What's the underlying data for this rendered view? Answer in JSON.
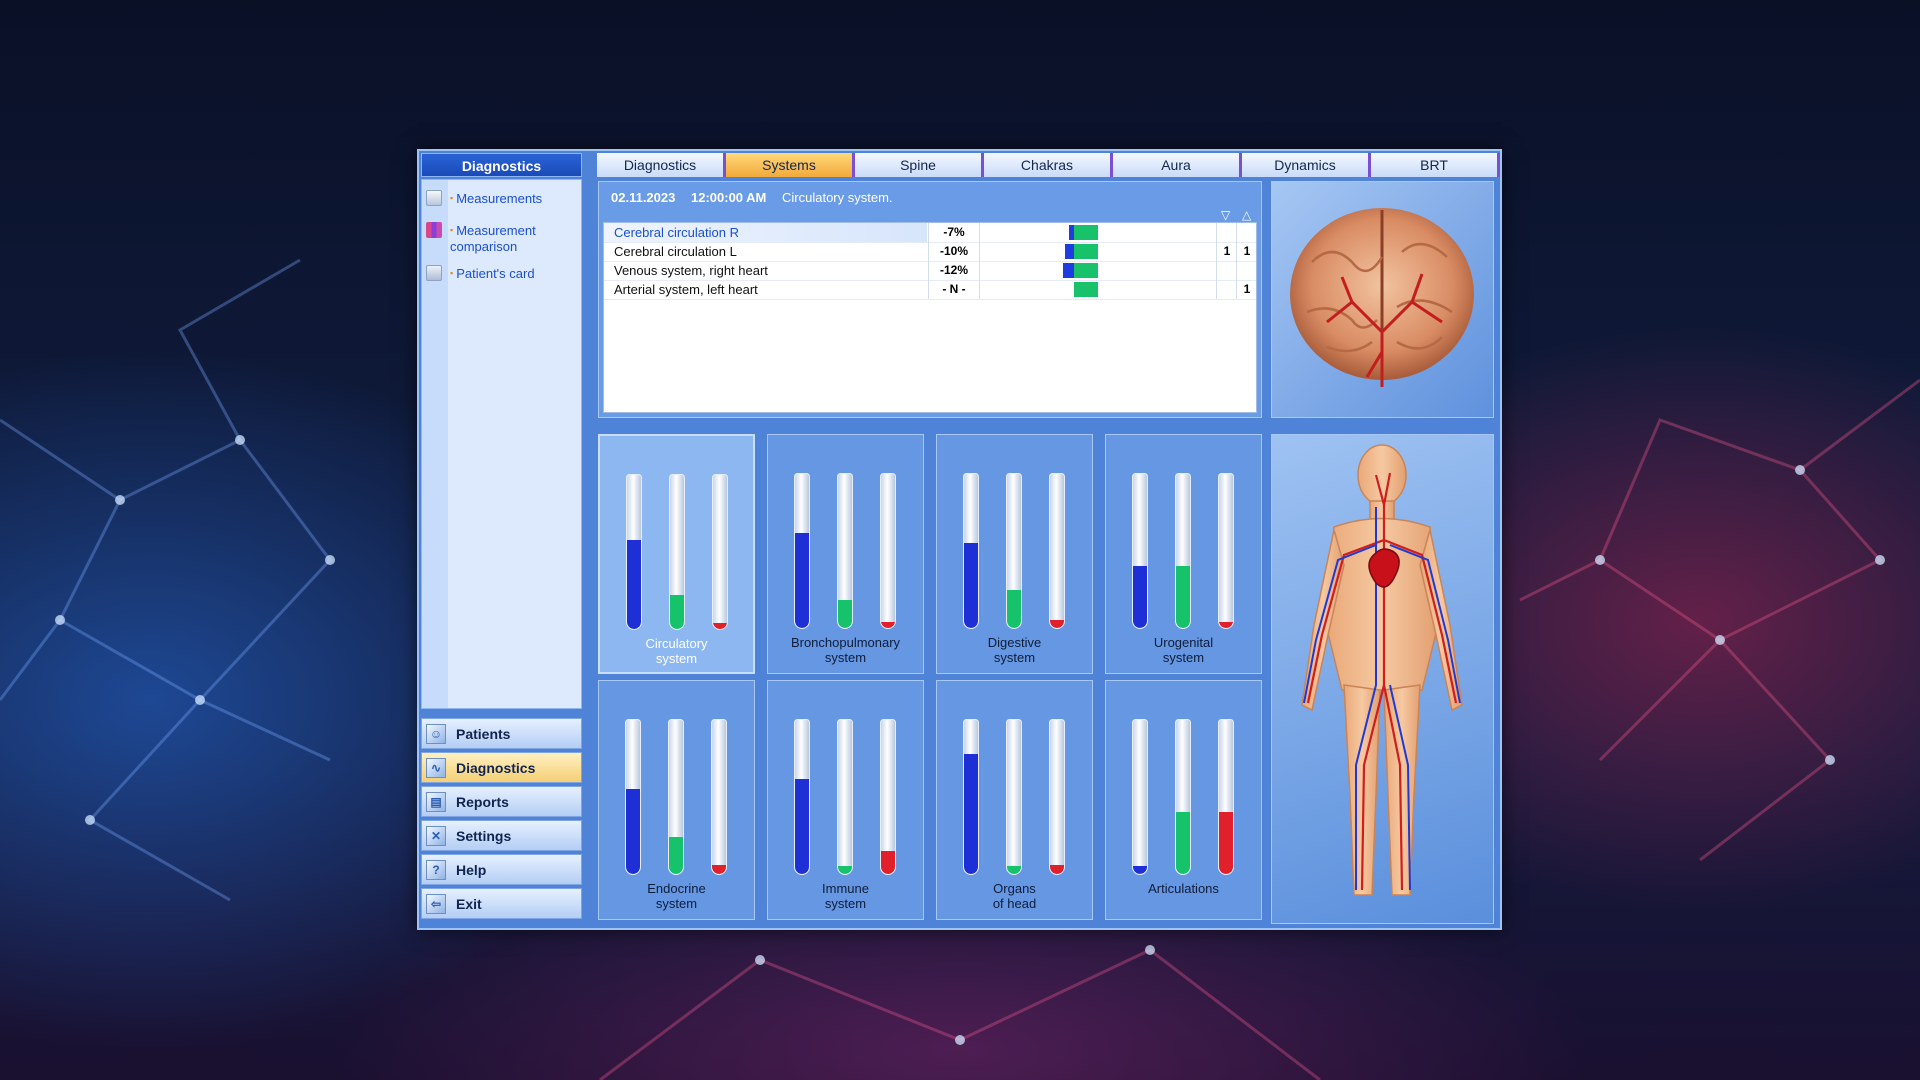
{
  "left_panel": {
    "title": "Diagnostics",
    "menu": [
      {
        "label": "Measurements",
        "icon": "table-icon"
      },
      {
        "label": "Measurement comparison",
        "icon": "chart-icon"
      },
      {
        "label": "Patient's card",
        "icon": "book-icon"
      }
    ]
  },
  "nav": [
    {
      "label": "Patients",
      "icon": "patients-icon"
    },
    {
      "label": "Diagnostics",
      "icon": "diagnostics-icon",
      "active": true
    },
    {
      "label": "Reports",
      "icon": "reports-icon"
    },
    {
      "label": "Settings",
      "icon": "settings-icon"
    },
    {
      "label": "Help",
      "icon": "help-icon"
    },
    {
      "label": "Exit",
      "icon": "exit-icon"
    }
  ],
  "tabs": [
    "Diagnostics",
    "Systems",
    "Spine",
    "Chakras",
    "Aura",
    "Dynamics",
    "BRT"
  ],
  "active_tab": "Systems",
  "info": {
    "date": "02.11.2023",
    "time": "12:00:00 AM",
    "system": "Circulatory system.",
    "sort_down": "▽",
    "sort_up": "△",
    "rows": [
      {
        "name": "Cerebral circulation R",
        "value": "-7%",
        "c1": "",
        "c2": "",
        "selected": true,
        "blue_level": 0.03
      },
      {
        "name": "Cerebral circulation L",
        "value": "-10%",
        "c1": "1",
        "c2": "1",
        "blue_level": 0.04
      },
      {
        "name": "Venous system, right heart",
        "value": "-12%",
        "c1": "",
        "c2": "",
        "blue_level": 0.05
      },
      {
        "name": "Arterial system, left heart",
        "value": "- N -",
        "c1": "",
        "c2": "1",
        "blue_level": 0
      }
    ]
  },
  "systems": [
    {
      "label_1": "Circulatory",
      "label_2": "system",
      "levels": [
        0.58,
        0.22,
        0.04
      ],
      "active": true
    },
    {
      "label_1": "Bronchopulmonary",
      "label_2": "system",
      "levels": [
        0.62,
        0.18,
        0.04
      ]
    },
    {
      "label_1": "Digestive",
      "label_2": "system",
      "levels": [
        0.55,
        0.25,
        0.05
      ]
    },
    {
      "label_1": "Urogenital",
      "label_2": "system",
      "levels": [
        0.4,
        0.4,
        0.04
      ]
    },
    {
      "label_1": "Endocrine",
      "label_2": "system",
      "levels": [
        0.55,
        0.24,
        0.06
      ]
    },
    {
      "label_1": "Immune",
      "label_2": "system",
      "levels": [
        0.62,
        0.05,
        0.15
      ]
    },
    {
      "label_1": "Organs",
      "label_2": "of head",
      "levels": [
        0.78,
        0.05,
        0.06
      ]
    },
    {
      "label_1": "Articulations",
      "label_2": "",
      "levels": [
        0.05,
        0.4,
        0.4
      ]
    }
  ],
  "colors": {
    "blue": "#1e2fd6",
    "green": "#16c26a",
    "red": "#e0202a",
    "accent_tab": "#f2a93b"
  }
}
